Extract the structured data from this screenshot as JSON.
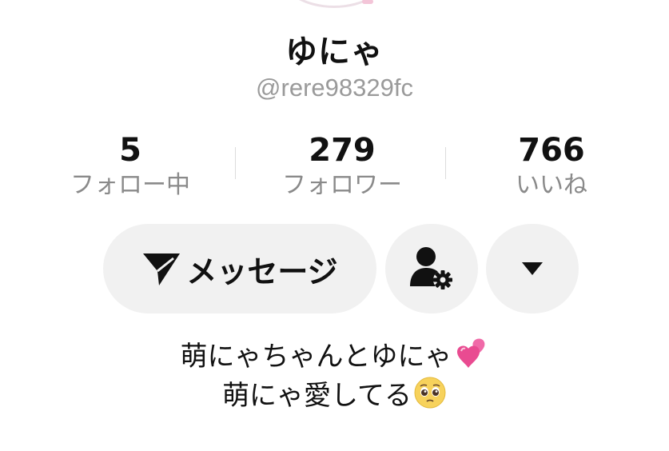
{
  "profile": {
    "display_name": "ゆにゃ",
    "username": "@rere98329fc"
  },
  "stats": [
    {
      "value": "5",
      "label": "フォロー中"
    },
    {
      "value": "279",
      "label": "フォロワー"
    },
    {
      "value": "766",
      "label": "いいね"
    }
  ],
  "actions": {
    "message_label": "メッセージ",
    "message_icon": "send-icon",
    "friend_settings_icon": "user-gear-icon",
    "more_icon": "caret-down-icon"
  },
  "bio": {
    "line1_text": "萌にゃちゃんとゆにゃ",
    "line1_emoji": "two-hearts",
    "line2_text": "萌にゃ愛してる",
    "line2_emoji": "pleading-face"
  },
  "colors": {
    "text": "#111111",
    "muted": "#8a8a8a",
    "button_bg": "#f1f1f1",
    "heart_pink": "#f06aa8"
  }
}
